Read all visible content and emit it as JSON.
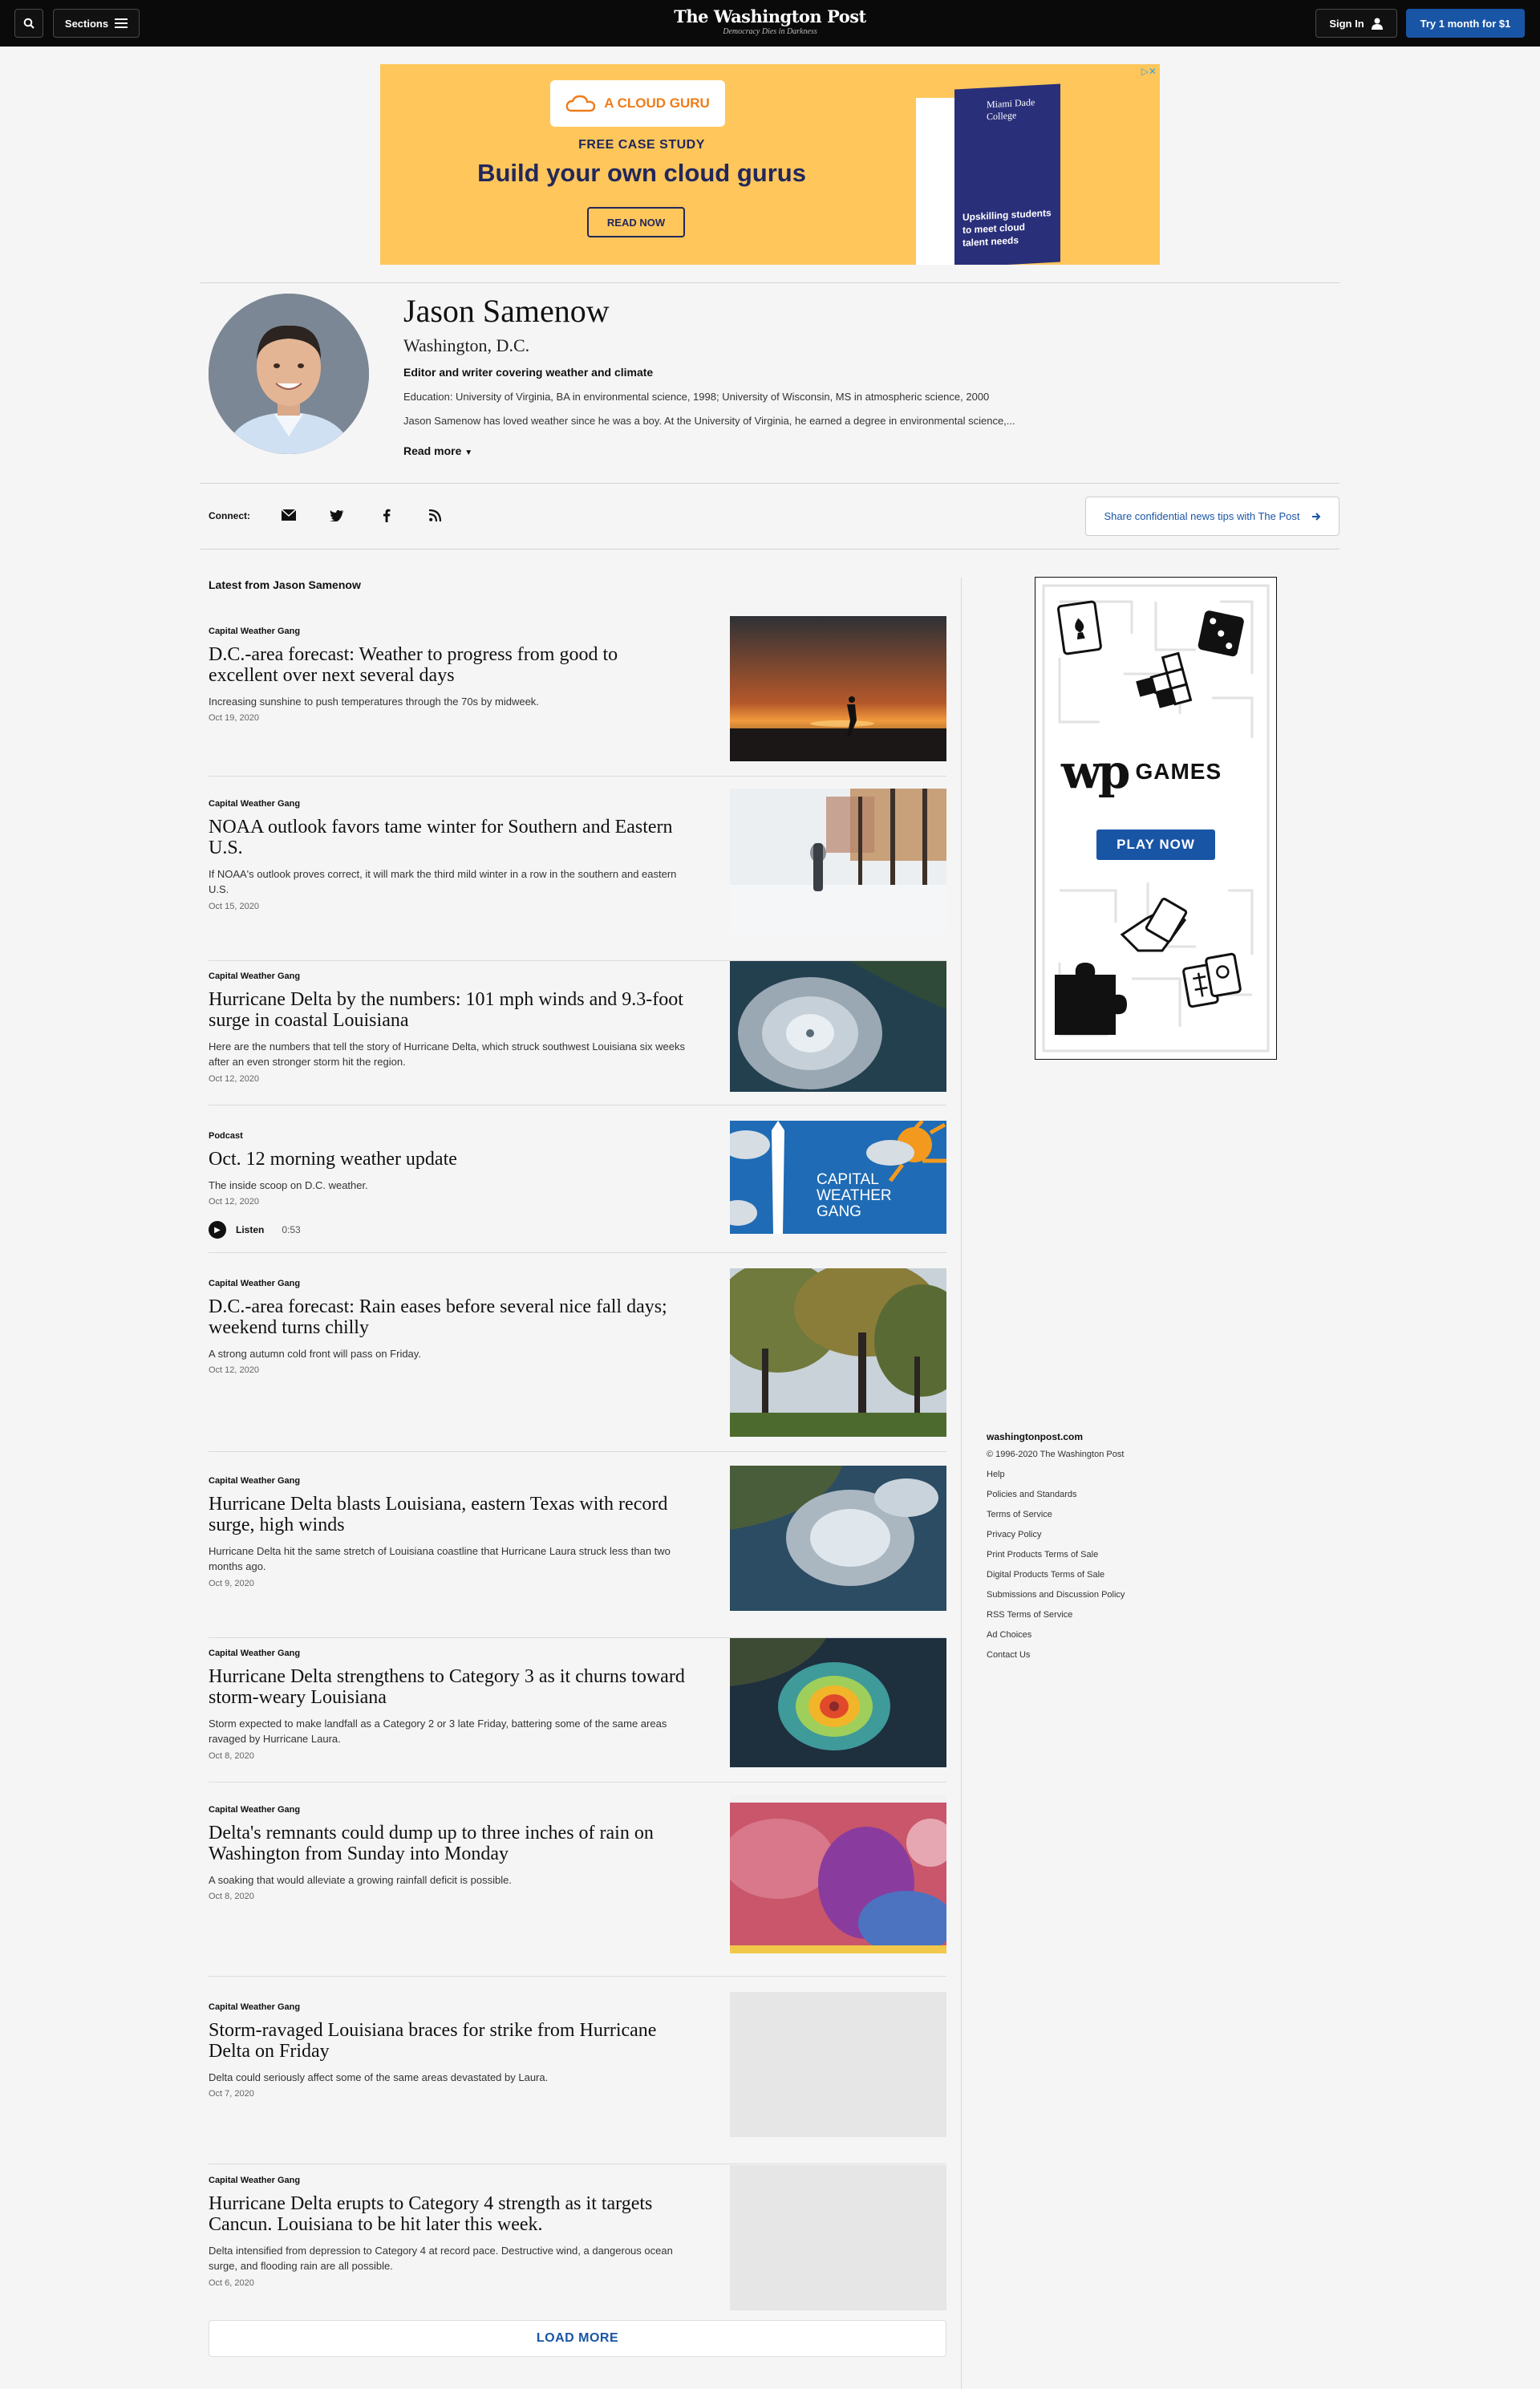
{
  "nav": {
    "sections_label": "Sections",
    "logo_name": "The Washington Post",
    "logo_tagline": "Democracy Dies in Darkness",
    "signin_label": "Sign In",
    "trial_label": "Try 1 month for $1"
  },
  "ad": {
    "brand": "A CLOUD GURU",
    "kicker": "FREE CASE STUDY",
    "headline": "Build your own cloud gurus",
    "cta": "READ NOW",
    "book_college": "Miami Dade College",
    "book_blurb": "Upskilling students to meet cloud talent needs"
  },
  "author": {
    "name": "Jason Samenow",
    "location": "Washington, D.C.",
    "title": "Editor and writer covering weather and climate",
    "education": "Education: University of Virginia, BA in environmental science, 1998; University of Wisconsin, MS in atmospheric science, 2000",
    "bio": "Jason Samenow has loved weather since he was a boy. At the University of Virginia, he earned a degree in environmental science,...",
    "read_more": "Read more"
  },
  "connect": {
    "label": "Connect:",
    "tips": "Share confidential news tips with The Post"
  },
  "latest_heading": "Latest from Jason Samenow",
  "articles": [
    {
      "kicker": "Capital Weather Gang",
      "headline": "D.C.-area forecast: Weather to progress from good to excellent over next several days",
      "blurb": "Increasing sunshine to push temperatures through the 70s by midweek.",
      "date": "Oct 19, 2020"
    },
    {
      "kicker": "Capital Weather Gang",
      "headline": "NOAA outlook favors tame winter for Southern and Eastern U.S.",
      "blurb": "If NOAA's outlook proves correct, it will mark the third mild winter in a row in the southern and eastern U.S.",
      "date": "Oct 15, 2020"
    },
    {
      "kicker": "Capital Weather Gang",
      "headline": "Hurricane Delta by the numbers: 101 mph winds and 9.3-foot surge in coastal Louisiana",
      "blurb": "Here are the numbers that tell the story of Hurricane Delta, which struck southwest Louisiana six weeks after an even stronger storm hit the region.",
      "date": "Oct 12, 2020"
    },
    {
      "kicker": "Podcast",
      "headline": "Oct. 12 morning weather update",
      "blurb": "The inside scoop on D.C. weather.",
      "date": "Oct 12, 2020",
      "listen": "Listen",
      "duration": "0:53",
      "thumb_text": "CAPITAL WEATHER GANG"
    },
    {
      "kicker": "Capital Weather Gang",
      "headline": "D.C.-area forecast: Rain eases before several nice fall days; weekend turns chilly",
      "blurb": "A strong autumn cold front will pass on Friday.",
      "date": "Oct 12, 2020"
    },
    {
      "kicker": "Capital Weather Gang",
      "headline": "Hurricane Delta blasts Louisiana, eastern Texas with record surge, high winds",
      "blurb": "Hurricane Delta hit the same stretch of Louisiana coastline that Hurricane Laura struck less than two months ago.",
      "date": "Oct 9, 2020"
    },
    {
      "kicker": "Capital Weather Gang",
      "headline": "Hurricane Delta strengthens to Category 3 as it churns toward storm-weary Louisiana",
      "blurb": "Storm expected to make landfall as a Category 2 or 3 late Friday, battering some of the same areas ravaged by Hurricane Laura.",
      "date": "Oct 8, 2020"
    },
    {
      "kicker": "Capital Weather Gang",
      "headline": "Delta's remnants could dump up to three inches of rain on Washington from Sunday into Monday",
      "blurb": "A soaking that would alleviate a growing rainfall deficit is possible.",
      "date": "Oct 8, 2020"
    },
    {
      "kicker": "Capital Weather Gang",
      "headline": "Storm-ravaged Louisiana braces for strike from Hurricane Delta on Friday",
      "blurb": "Delta could seriously affect some of the same areas devastated by Laura.",
      "date": "Oct 7, 2020"
    },
    {
      "kicker": "Capital Weather Gang",
      "headline": "Hurricane Delta erupts to Category 4 strength as it targets Cancun. Louisiana to be hit later this week.",
      "blurb": "Delta intensified from depression to Category 4 at record pace. Destructive wind, a dangerous ocean surge, and flooding rain are all possible.",
      "date": "Oct 6, 2020"
    }
  ],
  "load_more": "LOAD MORE",
  "games_ad": {
    "brand": "wp",
    "label": "GAMES",
    "cta": "PLAY NOW"
  },
  "footer": {
    "site": "washingtonpost.com",
    "links": [
      "© 1996-2020 The Washington Post",
      "Help",
      "Policies and Standards",
      "Terms of Service",
      "Privacy Policy",
      "Print Products Terms of Sale",
      "Digital Products Terms of Sale",
      "Submissions and Discussion Policy",
      "RSS Terms of Service",
      "Ad Choices",
      "Contact Us"
    ]
  },
  "icons": {
    "search": "search-icon",
    "menu": "hamburger-icon",
    "user": "user-icon",
    "email": "envelope-icon",
    "twitter": "twitter-icon",
    "facebook": "facebook-icon",
    "rss": "rss-icon",
    "arrow": "arrow-right-icon",
    "caret": "caret-down-icon",
    "play": "play-icon"
  },
  "colors": {
    "accent": "#1955a5",
    "nav_bg": "#0a0a0a",
    "ad_bg": "#fec65b"
  }
}
